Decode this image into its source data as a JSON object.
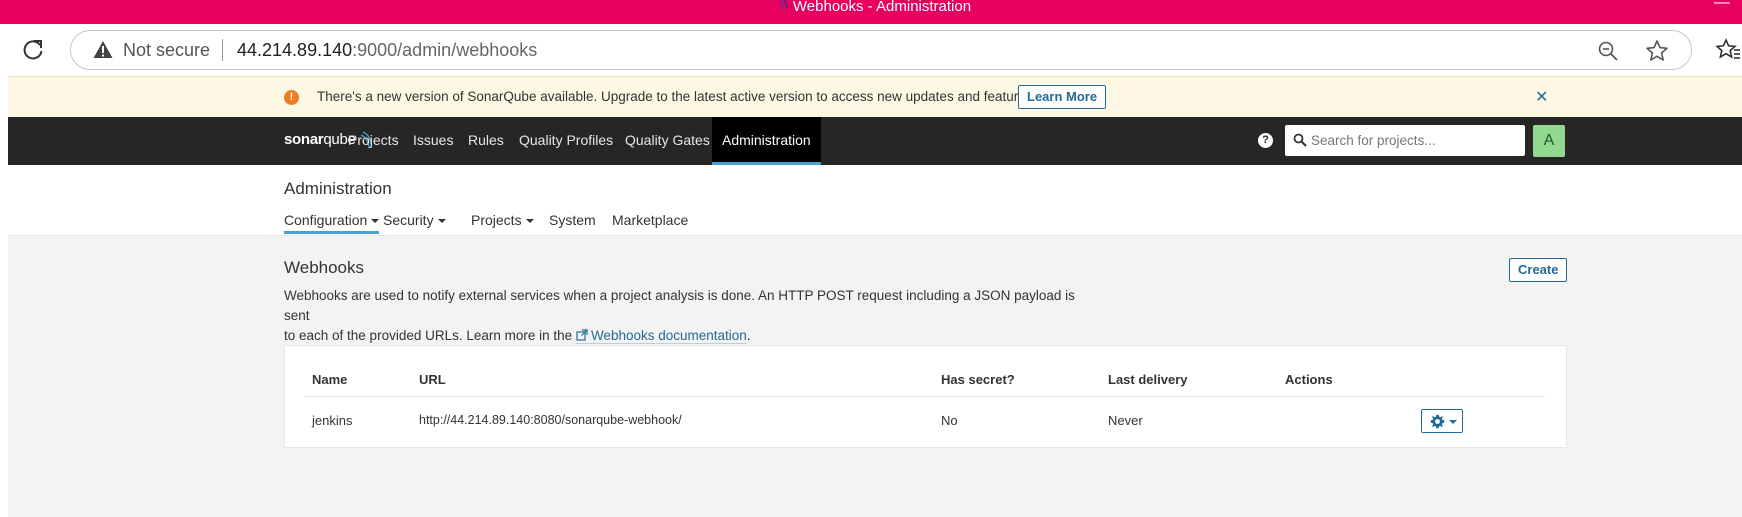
{
  "window": {
    "title": "Webhooks - Administration",
    "minimize_glyph": "—"
  },
  "browser": {
    "security_label": "Not secure",
    "url_host": "44.214.89.140",
    "url_rest": ":9000/admin/webhooks"
  },
  "banner": {
    "icon_glyph": "!",
    "text": "There's a new version of SonarQube available. Upgrade to the latest active version to access new updates and features.",
    "learn_more_label": "Learn More",
    "close_glyph": "✕"
  },
  "navbar": {
    "logo_sonar": "sonar",
    "logo_qube": "qube",
    "items": [
      {
        "label": "Projects"
      },
      {
        "label": "Issues"
      },
      {
        "label": "Rules"
      },
      {
        "label": "Quality Profiles"
      },
      {
        "label": "Quality Gates"
      },
      {
        "label": "Administration",
        "active": true
      }
    ],
    "help_glyph": "?",
    "search_placeholder": "Search for projects...",
    "avatar_letter": "A",
    "colors": {
      "navbar": "#262626",
      "active_underline": "#4b9fd5",
      "avatar": "#92d98f"
    }
  },
  "admin": {
    "title": "Administration",
    "tabs": [
      {
        "label": "Configuration",
        "has_caret": true,
        "active": true
      },
      {
        "label": "Security",
        "has_caret": true
      },
      {
        "label": "Projects",
        "has_caret": true
      },
      {
        "label": "System",
        "has_caret": false
      },
      {
        "label": "Marketplace",
        "has_caret": false
      }
    ]
  },
  "webhooks": {
    "title": "Webhooks",
    "create_label": "Create",
    "description_line1": "Webhooks are used to notify external services when a project analysis is done. An HTTP POST request including a JSON payload is sent",
    "description_line2": "to each of the provided URLs. Learn more in the",
    "doc_link_label": "Webhooks documentation",
    "description_end": ".",
    "table": {
      "columns": [
        "Name",
        "URL",
        "Has secret?",
        "Last delivery",
        "Actions"
      ],
      "rows": [
        {
          "name": "jenkins",
          "url": "http://44.214.89.140:8080/sonarqube-webhook/",
          "has_secret": "No",
          "last_delivery": "Never"
        }
      ]
    }
  },
  "icons": {
    "reload": "reload-icon",
    "warning": "warning-icon",
    "zoom": "zoom-icon",
    "bookmark": "star-icon",
    "favorites": "favorites-icon",
    "gear": "gear-icon",
    "external_link": "external-link-icon",
    "search": "search-icon"
  }
}
